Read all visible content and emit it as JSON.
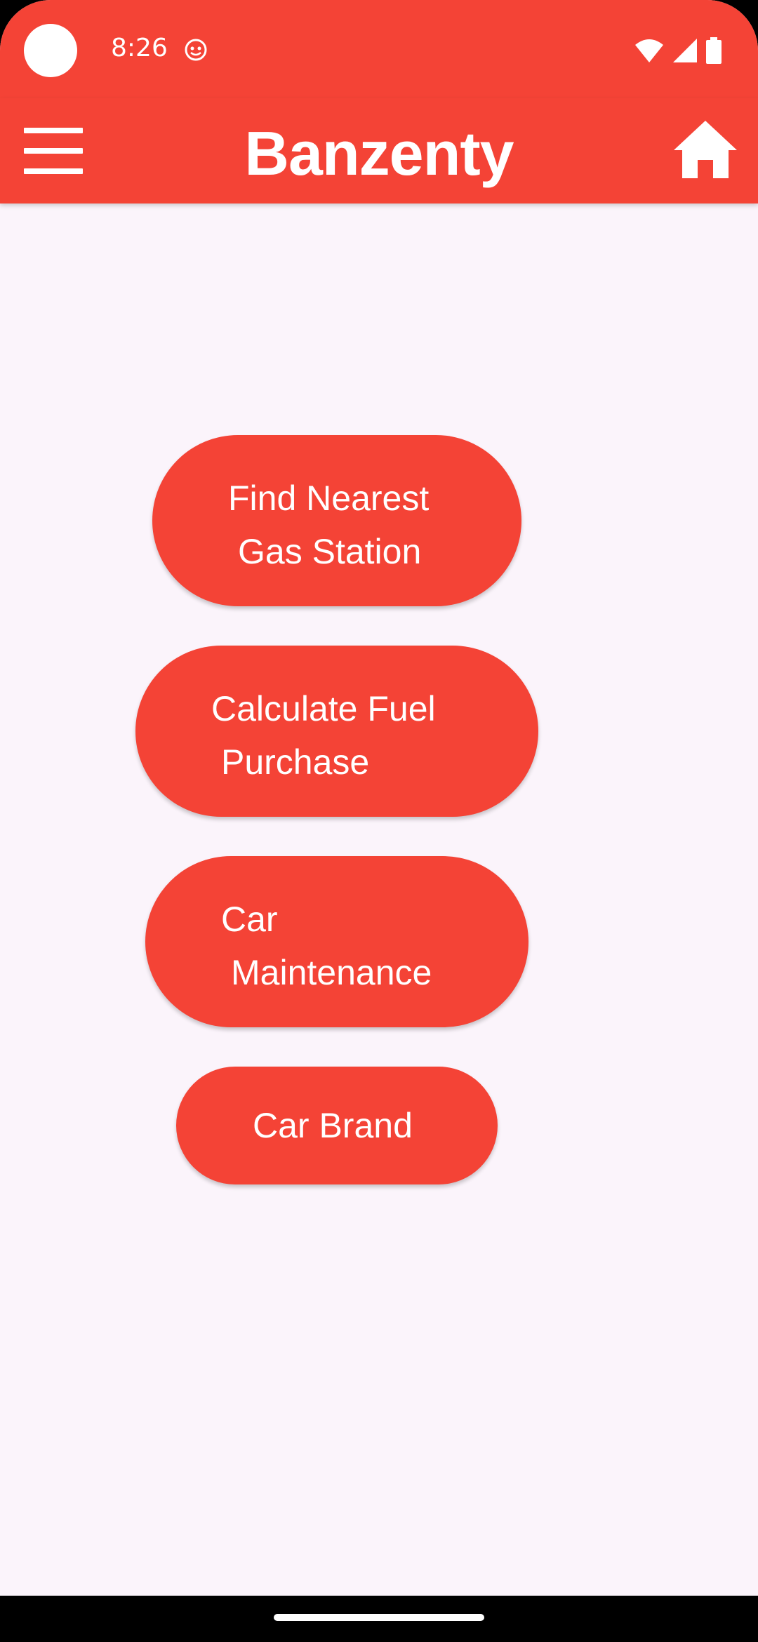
{
  "status_bar": {
    "time": "8:26",
    "icons": [
      "camera-cutout",
      "notification-icon",
      "wifi-icon",
      "cellular-signal-icon",
      "battery-icon"
    ]
  },
  "app_bar": {
    "title": "Banzenty",
    "menu_icon": "hamburger-menu-icon",
    "home_icon": "home-icon"
  },
  "buttons": {
    "find_gas": {
      "line1": "Find Nearest",
      "line2": "Gas Station"
    },
    "calc_fuel": {
      "line1": "Calculate Fuel",
      "line2": "Purchase"
    },
    "maintenance": {
      "line1": "Car",
      "line2": "Maintenance"
    },
    "brand": {
      "line1": "Car Brand"
    }
  },
  "colors": {
    "primary": "#F44336",
    "background": "#FBF4FB",
    "on_primary": "#FFFFFF"
  }
}
